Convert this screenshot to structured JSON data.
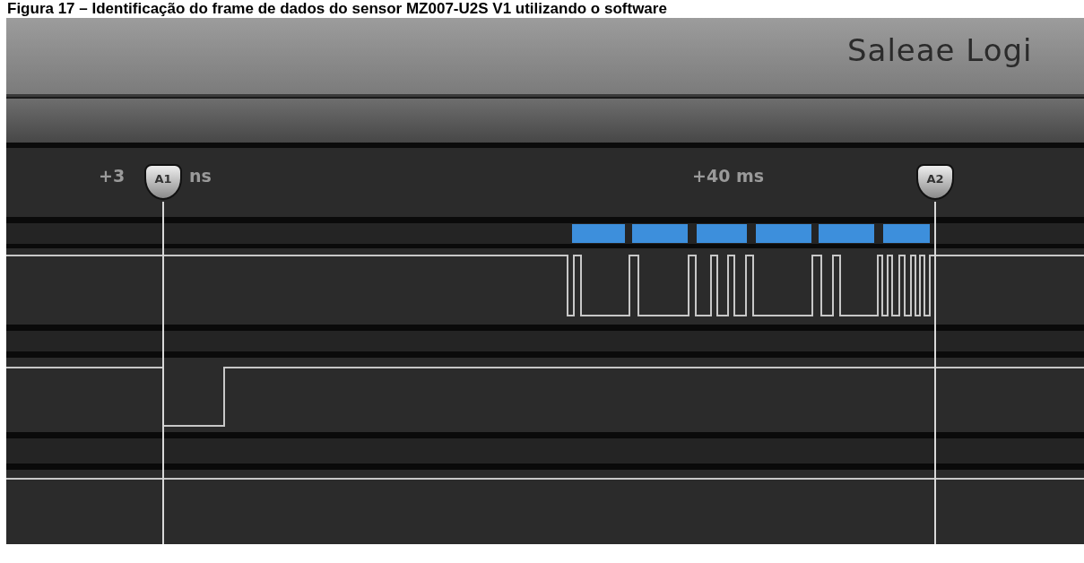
{
  "caption": "Figura 17 – Identificação do frame de dados do sensor MZ007-U2S V1 utilizando o software",
  "window": {
    "title": "Saleae Logi"
  },
  "timeline": {
    "labels": [
      {
        "text": "+3"
      },
      {
        "text": "ns"
      },
      {
        "text": "+40 ms"
      }
    ]
  },
  "markers": [
    {
      "label": "A1"
    },
    {
      "label": "A2"
    }
  ]
}
